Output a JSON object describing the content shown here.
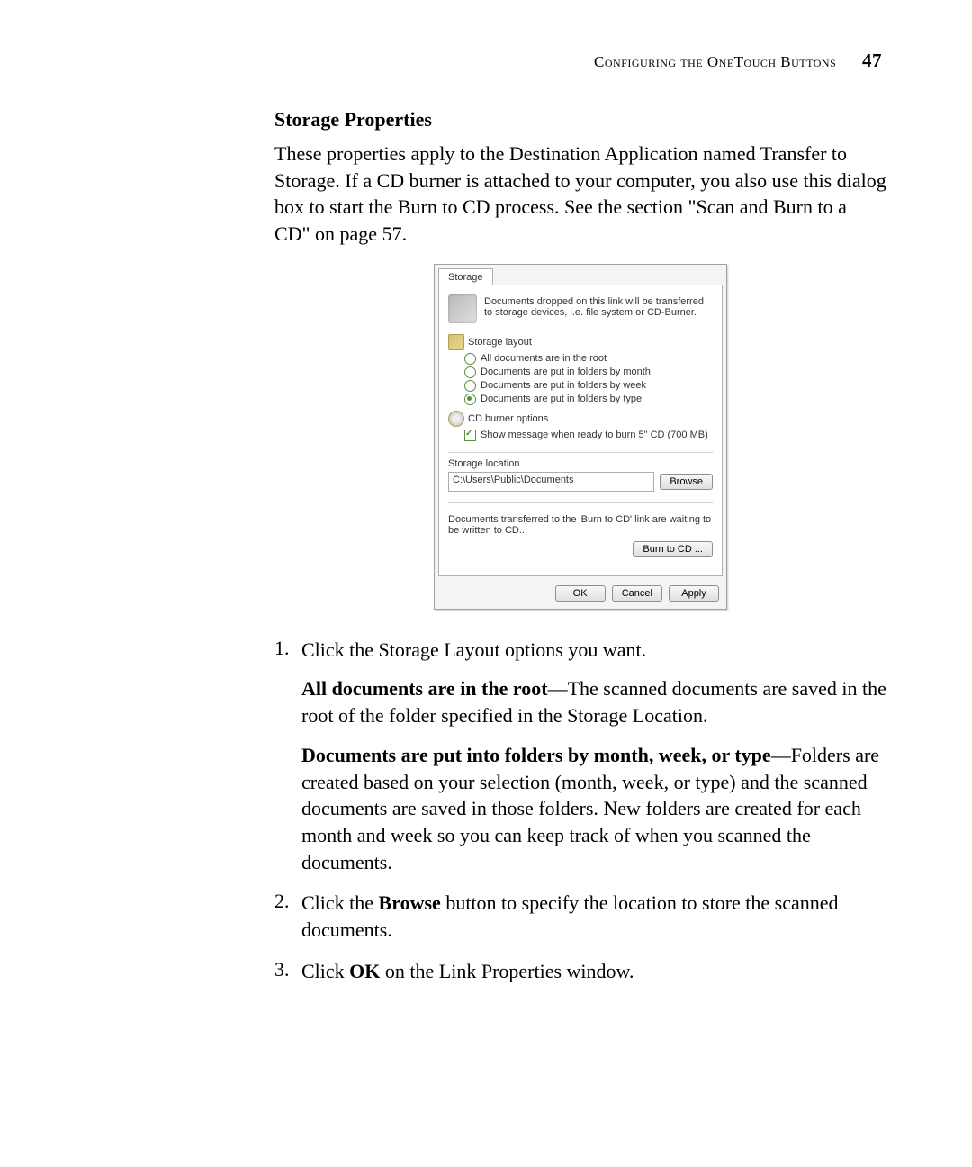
{
  "header": {
    "runningHead": "Configuring the OneTouch Buttons",
    "pageNumber": "47"
  },
  "content": {
    "sectionTitle": "Storage Properties",
    "introPara": "These properties apply to the Destination Application named Transfer to Storage. If a CD burner is attached to your computer, you also use this dialog box to start the Burn to CD process. See the section \"Scan and Burn to a CD\" on page 57."
  },
  "dialog": {
    "tab": "Storage",
    "introText": "Documents dropped on this link will be transferred to storage devices, i.e. file system or CD-Burner.",
    "storageLayout": {
      "header": "Storage layout",
      "opts": [
        "All documents are in the root",
        "Documents are put in folders by month",
        "Documents are put in folders by week",
        "Documents are put in folders by type"
      ]
    },
    "cdOptions": {
      "header": "CD burner options",
      "checkLabel": "Show message when ready to burn 5\" CD (700 MB)"
    },
    "storageLocation": {
      "label": "Storage location",
      "path": "C:\\Users\\Public\\Documents",
      "browse": "Browse"
    },
    "burnText": "Documents transferred to the 'Burn to CD' link are waiting to be written to CD...",
    "burnButton": "Burn to CD ...",
    "buttons": {
      "ok": "OK",
      "cancel": "Cancel",
      "apply": "Apply"
    }
  },
  "list": {
    "item1": {
      "num": "1.",
      "text": "Click the Storage Layout options you want.",
      "sub1a": "All documents are in the root",
      "sub1b": "—The scanned documents are saved in the root of the folder specified in the Storage Location.",
      "sub2a": "Documents are put into folders by month, week, or type",
      "sub2b": "—Folders are created based on your selection (month, week, or type) and the scanned documents are saved in those folders. New folders are created for each month and week so you can keep track of when you scanned the documents."
    },
    "item2": {
      "num": "2.",
      "textA": "Click the ",
      "textB": "Browse",
      "textC": " button to specify the location to store the scanned documents."
    },
    "item3": {
      "num": "3.",
      "textA": "Click ",
      "textB": "OK",
      "textC": " on the Link Properties window."
    }
  }
}
